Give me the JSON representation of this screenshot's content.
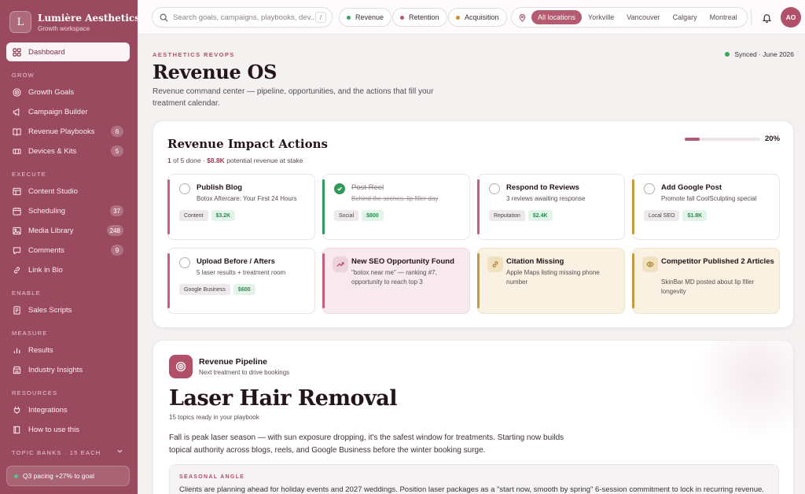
{
  "brand": {
    "logo_letter": "L",
    "name": "Lumière Aesthetics",
    "subtitle": "Growth workspace"
  },
  "sidebar": {
    "dashboard": "Dashboard",
    "sections": {
      "grow": "GROW",
      "execute": "EXECUTE",
      "enable": "ENABLE",
      "measure": "MEASURE",
      "resources": "RESOURCES",
      "topic_banks": "TOPIC BANKS · 15 EACH"
    },
    "items": {
      "growth_goals": "Growth Goals",
      "campaign_builder": "Campaign Builder",
      "revenue_playbooks": "Revenue Playbooks",
      "revenue_playbooks_count": "6",
      "devices_kits": "Devices & Kits",
      "devices_kits_count": "5",
      "content_studio": "Content Studio",
      "scheduling": "Scheduling",
      "scheduling_count": "37",
      "media_library": "Media Library",
      "media_library_count": "248",
      "comments": "Comments",
      "comments_count": "9",
      "link_in_bio": "Link in Bio",
      "sales_scripts": "Sales Scripts",
      "results": "Results",
      "industry_insights": "Industry Insights",
      "integrations": "Integrations",
      "how_to_use": "How to use this"
    },
    "pacing": "Q3 pacing +27% to goal"
  },
  "topbar": {
    "search_placeholder": "Search goals, campaigns, playbooks, dev...",
    "search_shortcut": "/",
    "filters": [
      {
        "label": "Revenue",
        "color": "#3aa35e"
      },
      {
        "label": "Retention",
        "color": "#c44d68"
      },
      {
        "label": "Acquisition",
        "color": "#d18a2a"
      }
    ],
    "locations": [
      "All locations",
      "Yorkville",
      "Vancouver",
      "Calgary",
      "Montreal"
    ],
    "active_location": "All locations",
    "avatar_initials": "AO"
  },
  "header": {
    "eyebrow": "AESTHETICS REVOPS",
    "title": "Revenue OS",
    "description": "Revenue command center — pipeline, opportunities, and the actions that fill your treatment calendar.",
    "synced": "Synced · June 2026"
  },
  "actions": {
    "title": "Revenue Impact Actions",
    "done_count": "1",
    "of_label": "of 5 done ·",
    "potential": "$8.8K",
    "potential_label": "potential revenue at stake",
    "progress_percent": 20,
    "progress_label": "20%",
    "tiles": [
      {
        "title": "Publish Blog",
        "desc": "Botox Aftercare: Your First 24 Hours",
        "tag": "Content",
        "value": "$3.2K",
        "done": false
      },
      {
        "title": "Post Reel",
        "desc": "Behind the scenes: lip filler day",
        "tag": "Social",
        "value": "$800",
        "done": true
      },
      {
        "title": "Respond to Reviews",
        "desc": "3 reviews awaiting response",
        "tag": "Reputation",
        "value": "$2.4K",
        "done": false
      },
      {
        "title": "Add Google Post",
        "desc": "Promote fall CoolSculpting special",
        "tag": "Local SEO",
        "value": "$1.8K",
        "done": false
      },
      {
        "title": "Upload Before / Afters",
        "desc": "5 laser results + treatment room",
        "tag": "Google Business",
        "value": "$600",
        "done": false
      }
    ],
    "alerts": [
      {
        "title": "New SEO Opportunity Found",
        "desc": "\"botox near me\" — ranking #7, opportunity to reach top 3",
        "icon": "trend-up-icon"
      },
      {
        "title": "Citation Missing",
        "desc": "Apple Maps listing missing phone number",
        "icon": "link-icon"
      },
      {
        "title": "Competitor Published 2 Articles",
        "desc": "SkinBar MD posted about lip filler longevity",
        "icon": "eye-icon"
      }
    ]
  },
  "pipeline": {
    "label": "Revenue Pipeline",
    "sub": "Next treatment to drive bookings",
    "title": "Laser Hair Removal",
    "topics": "15 topics ready in your playbook",
    "description": "Fall is peak laser season — with sun exposure dropping, it's the safest window for treatments. Starting now builds topical authority across blogs, reels, and Google Business before the winter booking surge.",
    "angle_eyebrow": "SEASONAL ANGLE",
    "angle_text": "Clients are planning ahead for holiday events and 2027 weddings. Position laser packages as a \"start now, smooth by spring\" 6-session commitment to lock in recurring revenue."
  }
}
